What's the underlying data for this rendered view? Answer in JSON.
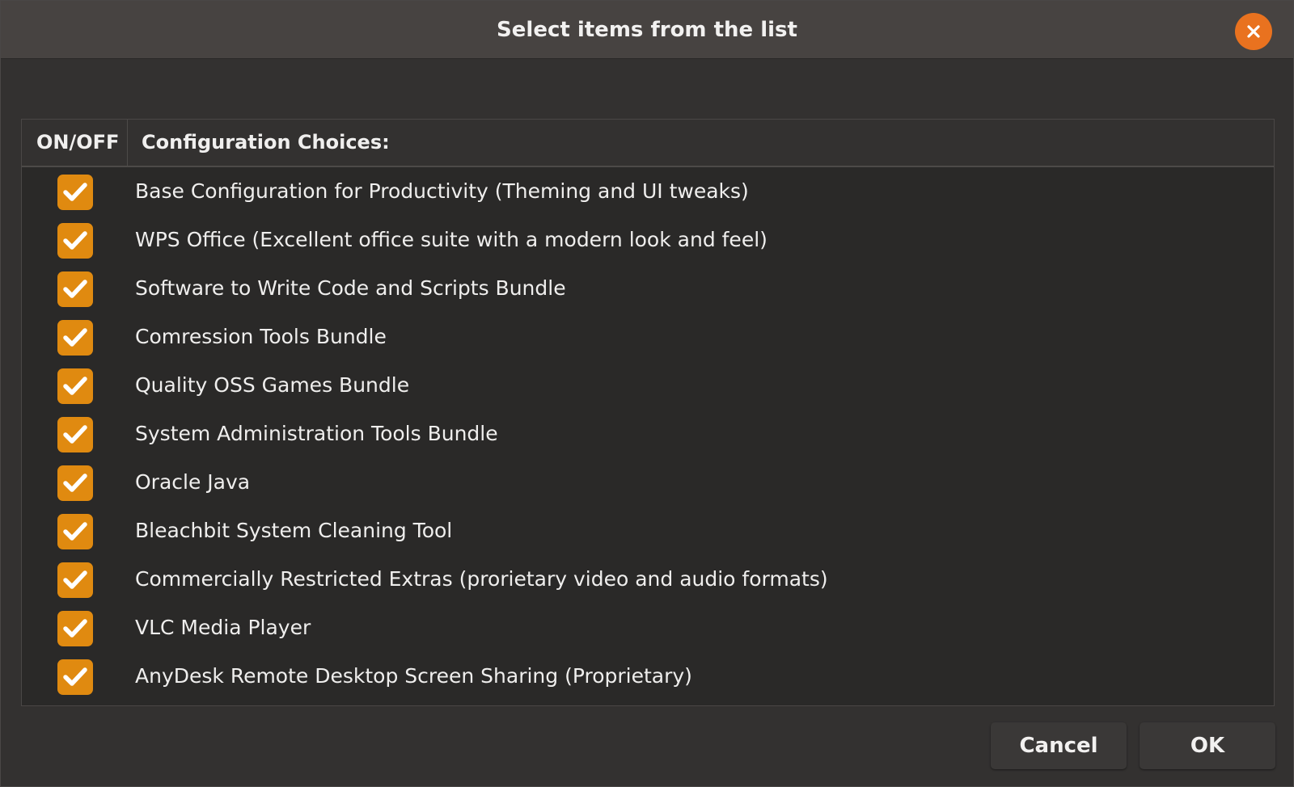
{
  "window": {
    "title": "Select items from the list"
  },
  "list": {
    "columns": {
      "onoff": "ON/OFF",
      "choices": "Configuration Choices:"
    },
    "items": [
      {
        "label": "Base Configuration for Productivity (Theming and UI tweaks)",
        "checked": true
      },
      {
        "label": "WPS Office (Excellent office suite with a modern look and feel)",
        "checked": true
      },
      {
        "label": "Software to Write Code and Scripts Bundle",
        "checked": true
      },
      {
        "label": "Comression Tools Bundle",
        "checked": true
      },
      {
        "label": "Quality OSS Games Bundle",
        "checked": true
      },
      {
        "label": "System Administration Tools Bundle",
        "checked": true
      },
      {
        "label": "Oracle Java",
        "checked": true
      },
      {
        "label": "Bleachbit System Cleaning Tool",
        "checked": true
      },
      {
        "label": "Commercially Restricted Extras (prorietary video and audio formats)",
        "checked": true
      },
      {
        "label": "VLC Media Player",
        "checked": true
      },
      {
        "label": "AnyDesk Remote Desktop Screen Sharing (Proprietary)",
        "checked": true
      }
    ]
  },
  "buttons": {
    "cancel": "Cancel",
    "ok": "OK"
  },
  "colors": {
    "accent": "#e08a10",
    "close": "#e9721f",
    "titlebar": "#474341",
    "background": "#333130",
    "list_background": "#2a2928"
  },
  "icons": {
    "close": "close-icon",
    "check": "checkmark-icon"
  }
}
